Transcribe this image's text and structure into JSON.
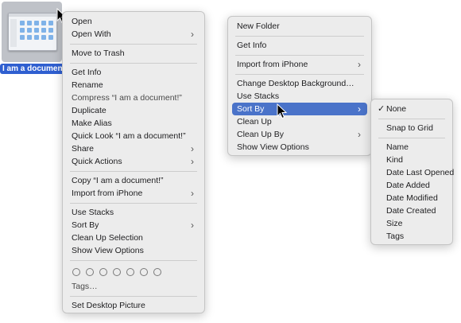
{
  "desktop_icon": {
    "label": "I am a document!"
  },
  "context_menu": {
    "items": [
      {
        "label": "Open",
        "submenu": false
      },
      {
        "label": "Open With",
        "submenu": true
      },
      {
        "label": "Move to Trash",
        "submenu": false
      },
      {
        "label": "Get Info",
        "submenu": false
      },
      {
        "label": "Rename",
        "submenu": false
      },
      {
        "label": "Compress “I am a document!”",
        "submenu": false
      },
      {
        "label": "Duplicate",
        "submenu": false
      },
      {
        "label": "Make Alias",
        "submenu": false
      },
      {
        "label": "Quick Look “I am a document!”",
        "submenu": false
      },
      {
        "label": "Share",
        "submenu": true
      },
      {
        "label": "Quick Actions",
        "submenu": true
      },
      {
        "label": "Copy “I am a document!”",
        "submenu": false
      },
      {
        "label": "Import from iPhone",
        "submenu": true
      },
      {
        "label": "Use Stacks",
        "submenu": false
      },
      {
        "label": "Sort By",
        "submenu": true
      },
      {
        "label": "Clean Up Selection",
        "submenu": false
      },
      {
        "label": "Show View Options",
        "submenu": false
      },
      {
        "label": "Tags…",
        "submenu": false
      },
      {
        "label": "Set Desktop Picture",
        "submenu": false
      }
    ],
    "tag_colors": [
      "none",
      "none",
      "none",
      "none",
      "none",
      "none",
      "none"
    ]
  },
  "desktop_menu": {
    "items": [
      {
        "label": "New Folder"
      },
      {
        "label": "Get Info"
      },
      {
        "label": "Import from iPhone"
      },
      {
        "label": "Change Desktop Background…"
      },
      {
        "label": "Use Stacks"
      },
      {
        "label": "Sort By"
      },
      {
        "label": "Clean Up"
      },
      {
        "label": "Clean Up By"
      },
      {
        "label": "Show View Options"
      }
    ],
    "highlighted": "Sort By"
  },
  "sort_submenu": {
    "checkmark": "✓",
    "items": [
      {
        "label": "None",
        "checked": true
      },
      {
        "label": "Snap to Grid"
      },
      {
        "label": "Name"
      },
      {
        "label": "Kind"
      },
      {
        "label": "Date Last Opened"
      },
      {
        "label": "Date Added"
      },
      {
        "label": "Date Modified"
      },
      {
        "label": "Date Created"
      },
      {
        "label": "Size"
      },
      {
        "label": "Tags"
      }
    ]
  },
  "icons": {
    "submenu": "chevron-right-icon",
    "cursor": "arrow-cursor-icon"
  },
  "colors": {
    "highlight": "#4a73c9",
    "selection_label": "#2f5fd0",
    "menu_bg": "#ececec"
  }
}
